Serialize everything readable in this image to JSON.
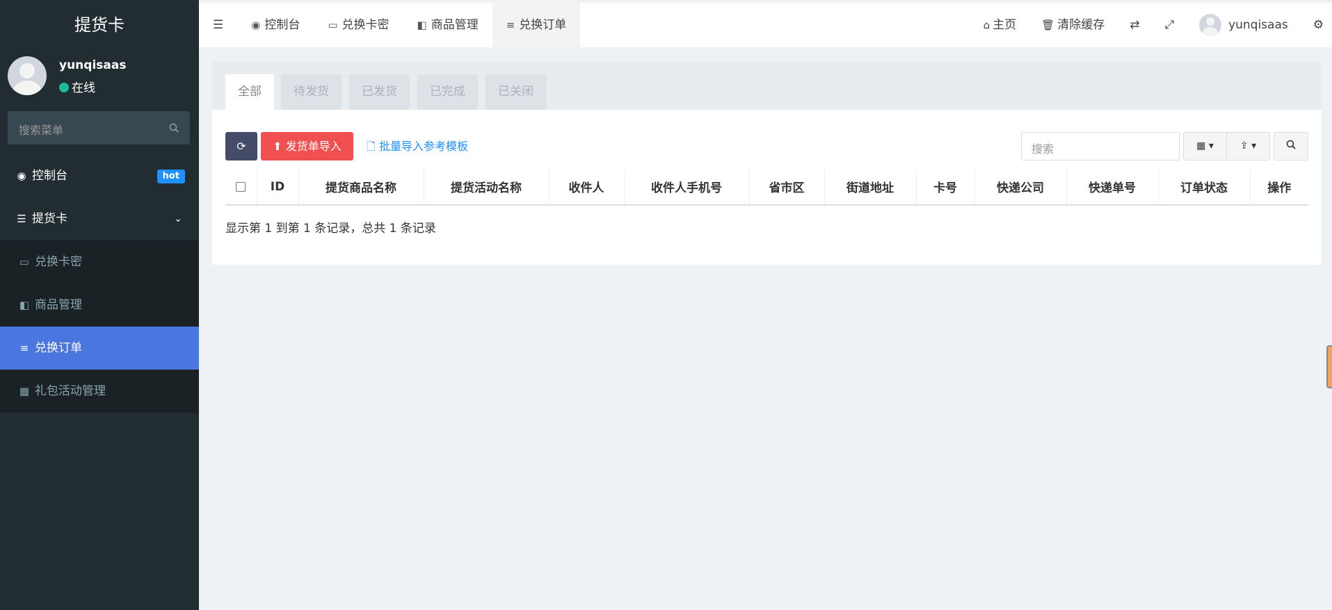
{
  "sidebar": {
    "brand": "提货卡",
    "user": {
      "name": "yunqisaas",
      "status": "在线"
    },
    "search_placeholder": "搜索菜单",
    "items": [
      {
        "label": "控制台",
        "badge": "hot"
      },
      {
        "label": "提货卡"
      }
    ],
    "sub_items": [
      {
        "label": "兑换卡密"
      },
      {
        "label": "商品管理"
      },
      {
        "label": "兑换订单",
        "active": true
      },
      {
        "label": "礼包活动管理"
      }
    ]
  },
  "topnav": {
    "tabs": [
      {
        "label": "控制台"
      },
      {
        "label": "兑换卡密"
      },
      {
        "label": "商品管理"
      },
      {
        "label": "兑换订单",
        "active": true
      }
    ],
    "right": {
      "home": "主页",
      "clear_cache": "清除缓存",
      "username": "yunqisaas"
    }
  },
  "main": {
    "status_tabs": [
      "全部",
      "待发货",
      "已发货",
      "已完成",
      "已关闭"
    ],
    "toolbar": {
      "import_label": "发货单导入",
      "template_link": "批量导入参考模板",
      "search_placeholder": "搜索"
    },
    "table": {
      "columns": [
        "ID",
        "提货商品名称",
        "提货活动名称",
        "收件人",
        "收件人手机号",
        "省市区",
        "街道地址",
        "卡号",
        "快递公司",
        "快递单号",
        "订单状态",
        "操作"
      ]
    },
    "summary": "显示第 1 到第 1 条记录，总共 1 条记录"
  },
  "colors": {
    "sidebar_bg": "#222d32",
    "active_blue": "#4a76e0",
    "danger": "#f05050",
    "hot_badge": "#1e90ff",
    "online": "#18bc9c"
  }
}
